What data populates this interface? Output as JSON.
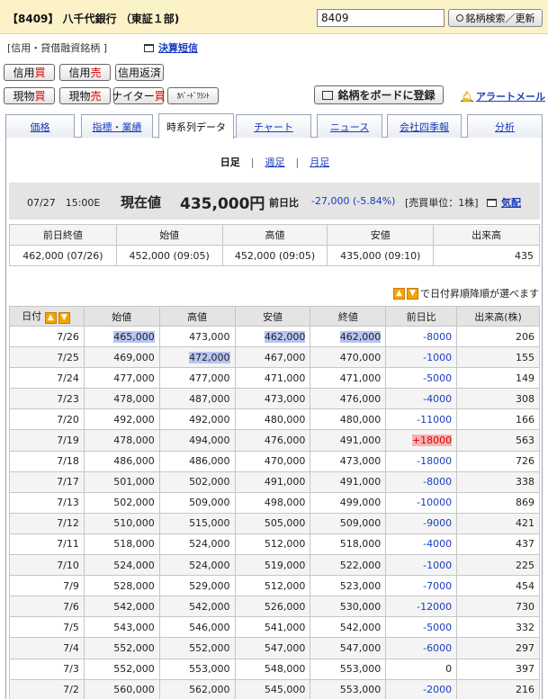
{
  "header": {
    "title": "【8409】 八千代銀行 （東証１部)",
    "code_value": "8409",
    "search_label": "銘柄検索／更新"
  },
  "subline": {
    "category": "[信用・貸借融資銘柄 ]",
    "kessan_link": "決算短信"
  },
  "buttons": {
    "shinyo_kai_a": "信用",
    "shinyo_kai_b": "買",
    "shinyo_uri_a": "信用",
    "shinyo_uri_b": "売",
    "shinyo_hensai": "信用返済",
    "genbutsu_kai_a": "現物",
    "genbutsu_kai_b": "買",
    "genbutsu_uri_a": "現物",
    "genbutsu_uri_b": "売",
    "night_a": "ナイター",
    "night_b": "買",
    "covered_warrant": "ｶﾊﾞｰﾄﾞﾜﾗﾝﾄ",
    "board_register": "銘柄をボードに登録",
    "alert_mail": "アラートメール"
  },
  "tabs": [
    "価格",
    "指標・業績",
    "時系列データ",
    "チャート",
    "ニュース",
    "会社四季報",
    "分析"
  ],
  "period": {
    "daily": "日足",
    "weekly": "週足",
    "monthly": "月足"
  },
  "price_bar": {
    "time": "07/27　15:00E",
    "label": "現在値",
    "price": "435,000円",
    "diff_label": "前日比",
    "diff": "-27,000 (-5.84%)",
    "unit": "[売買単位：1株]",
    "kehai": "気配"
  },
  "summary": {
    "headers": [
      "前日終値",
      "始値",
      "高値",
      "安値",
      "出来高"
    ],
    "values": [
      "462,000 (07/26)",
      "452,000 (09:05)",
      "452,000 (09:05)",
      "435,000 (09:10)",
      "435"
    ]
  },
  "sort_note": "で日付昇順降順が選べます",
  "history": {
    "headers": [
      "日付",
      "始値",
      "高値",
      "安値",
      "終値",
      "前日比",
      "出来高(株)"
    ],
    "rows": [
      [
        "7/26",
        "465,000",
        "473,000",
        "462,000",
        "462,000",
        "-8000",
        "206"
      ],
      [
        "7/25",
        "469,000",
        "472,000",
        "467,000",
        "470,000",
        "-1000",
        "155"
      ],
      [
        "7/24",
        "477,000",
        "477,000",
        "471,000",
        "471,000",
        "-5000",
        "149"
      ],
      [
        "7/23",
        "478,000",
        "487,000",
        "473,000",
        "476,000",
        "-4000",
        "308"
      ],
      [
        "7/20",
        "492,000",
        "492,000",
        "480,000",
        "480,000",
        "-11000",
        "166"
      ],
      [
        "7/19",
        "478,000",
        "494,000",
        "476,000",
        "491,000",
        "+18000",
        "563"
      ],
      [
        "7/18",
        "486,000",
        "486,000",
        "470,000",
        "473,000",
        "-18000",
        "726"
      ],
      [
        "7/17",
        "501,000",
        "502,000",
        "491,000",
        "491,000",
        "-8000",
        "338"
      ],
      [
        "7/13",
        "502,000",
        "509,000",
        "498,000",
        "499,000",
        "-10000",
        "869"
      ],
      [
        "7/12",
        "510,000",
        "515,000",
        "505,000",
        "509,000",
        "-9000",
        "421"
      ],
      [
        "7/11",
        "518,000",
        "524,000",
        "512,000",
        "518,000",
        "-4000",
        "437"
      ],
      [
        "7/10",
        "524,000",
        "524,000",
        "519,000",
        "522,000",
        "-1000",
        "225"
      ],
      [
        "7/9",
        "528,000",
        "529,000",
        "512,000",
        "523,000",
        "-7000",
        "454"
      ],
      [
        "7/6",
        "542,000",
        "542,000",
        "526,000",
        "530,000",
        "-12000",
        "730"
      ],
      [
        "7/5",
        "543,000",
        "546,000",
        "541,000",
        "542,000",
        "-5000",
        "332"
      ],
      [
        "7/4",
        "552,000",
        "552,000",
        "547,000",
        "547,000",
        "-6000",
        "297"
      ],
      [
        "7/3",
        "552,000",
        "553,000",
        "548,000",
        "553,000",
        "0",
        "397"
      ],
      [
        "7/2",
        "560,000",
        "562,000",
        "545,000",
        "553,000",
        "-2000",
        "216"
      ]
    ],
    "highlights": [
      {
        "row": 0,
        "col": 1,
        "tone": "blue"
      },
      {
        "row": 0,
        "col": 3,
        "tone": "blue"
      },
      {
        "row": 0,
        "col": 4,
        "tone": "blue"
      },
      {
        "row": 1,
        "col": 2,
        "tone": "blue"
      },
      {
        "row": 5,
        "col": 5,
        "tone": "red"
      }
    ]
  }
}
